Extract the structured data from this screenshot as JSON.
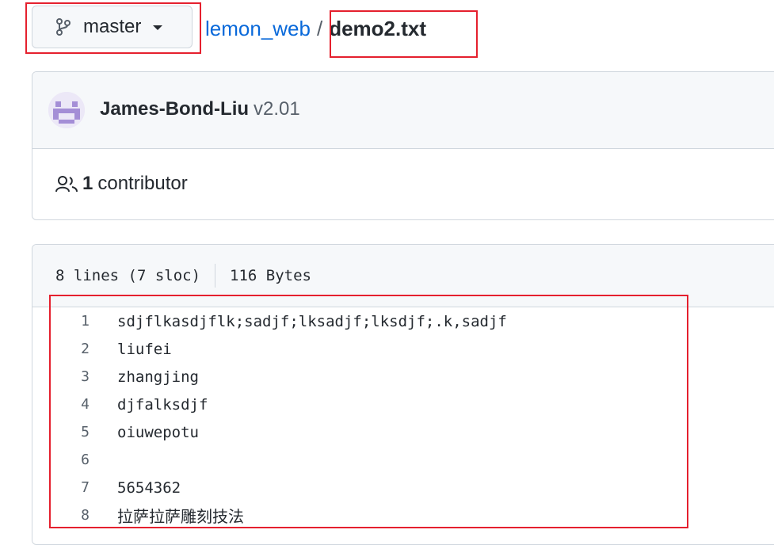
{
  "branch": {
    "label": "master"
  },
  "breadcrumb": {
    "repo": "lemon_web",
    "separator": "/",
    "file": "demo2.txt"
  },
  "commit": {
    "author": "James-Bond-Liu",
    "message": "v2.01"
  },
  "contributors": {
    "count": "1",
    "label": "contributor"
  },
  "file_info": {
    "lines": "8 lines (7 sloc)",
    "size": "116 Bytes"
  },
  "code": {
    "lines": [
      {
        "n": "1",
        "text": "sdjflkasdjflk;sadjf;lksadjf;lksdjf;.k,sadjf"
      },
      {
        "n": "2",
        "text": "liufei"
      },
      {
        "n": "3",
        "text": "zhangjing"
      },
      {
        "n": "4",
        "text": "djfalksdjf"
      },
      {
        "n": "5",
        "text": "oiuwepotu"
      },
      {
        "n": "6",
        "text": ""
      },
      {
        "n": "7",
        "text": "5654362"
      },
      {
        "n": "8",
        "text": "拉萨拉萨雕刻技法"
      }
    ]
  },
  "colors": {
    "link": "#0969da",
    "highlight": "#e5202e",
    "header_bg": "#f6f8fa",
    "border": "#d0d7de"
  }
}
